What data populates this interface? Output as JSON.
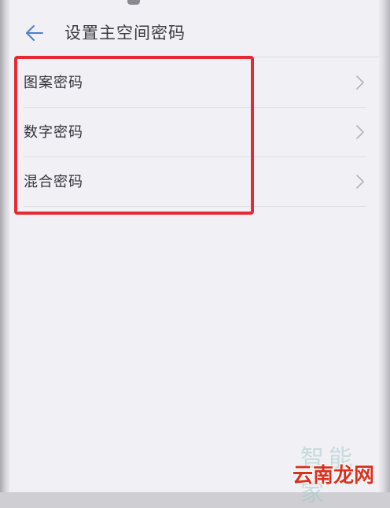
{
  "header": {
    "back_icon": "arrow-left-icon",
    "title": "设置主空间密码"
  },
  "menu": {
    "items": [
      {
        "label": "图案密码",
        "icon": "chevron-right-icon"
      },
      {
        "label": "数字密码",
        "icon": "chevron-right-icon"
      },
      {
        "label": "混合密码",
        "icon": "chevron-right-icon"
      }
    ]
  },
  "annotation": {
    "highlight_color": "#e52a34"
  },
  "watermark": {
    "top_text": "智能家",
    "bottom_text": "云南龙网"
  },
  "colors": {
    "accent_back_arrow": "#4a7fd0",
    "background": "#f1f1f5"
  }
}
